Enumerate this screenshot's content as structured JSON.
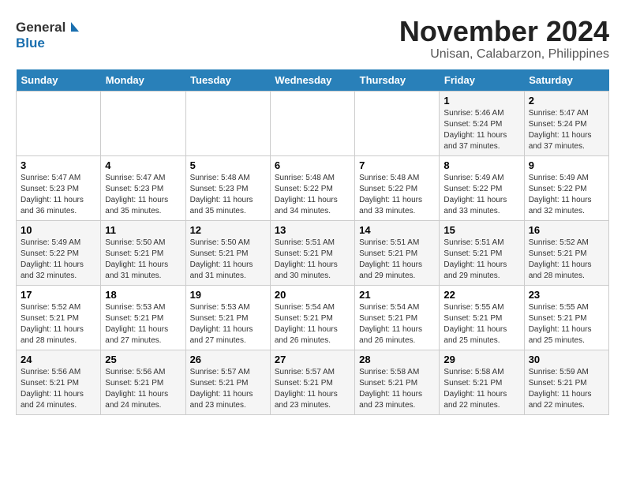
{
  "header": {
    "logo_general": "General",
    "logo_blue": "Blue",
    "month_title": "November 2024",
    "location": "Unisan, Calabarzon, Philippines"
  },
  "weekdays": [
    "Sunday",
    "Monday",
    "Tuesday",
    "Wednesday",
    "Thursday",
    "Friday",
    "Saturday"
  ],
  "weeks": [
    [
      {
        "day": "",
        "sunrise": "",
        "sunset": "",
        "daylight": ""
      },
      {
        "day": "",
        "sunrise": "",
        "sunset": "",
        "daylight": ""
      },
      {
        "day": "",
        "sunrise": "",
        "sunset": "",
        "daylight": ""
      },
      {
        "day": "",
        "sunrise": "",
        "sunset": "",
        "daylight": ""
      },
      {
        "day": "",
        "sunrise": "",
        "sunset": "",
        "daylight": ""
      },
      {
        "day": "1",
        "sunrise": "Sunrise: 5:46 AM",
        "sunset": "Sunset: 5:24 PM",
        "daylight": "Daylight: 11 hours and 37 minutes."
      },
      {
        "day": "2",
        "sunrise": "Sunrise: 5:47 AM",
        "sunset": "Sunset: 5:24 PM",
        "daylight": "Daylight: 11 hours and 37 minutes."
      }
    ],
    [
      {
        "day": "3",
        "sunrise": "Sunrise: 5:47 AM",
        "sunset": "Sunset: 5:23 PM",
        "daylight": "Daylight: 11 hours and 36 minutes."
      },
      {
        "day": "4",
        "sunrise": "Sunrise: 5:47 AM",
        "sunset": "Sunset: 5:23 PM",
        "daylight": "Daylight: 11 hours and 35 minutes."
      },
      {
        "day": "5",
        "sunrise": "Sunrise: 5:48 AM",
        "sunset": "Sunset: 5:23 PM",
        "daylight": "Daylight: 11 hours and 35 minutes."
      },
      {
        "day": "6",
        "sunrise": "Sunrise: 5:48 AM",
        "sunset": "Sunset: 5:22 PM",
        "daylight": "Daylight: 11 hours and 34 minutes."
      },
      {
        "day": "7",
        "sunrise": "Sunrise: 5:48 AM",
        "sunset": "Sunset: 5:22 PM",
        "daylight": "Daylight: 11 hours and 33 minutes."
      },
      {
        "day": "8",
        "sunrise": "Sunrise: 5:49 AM",
        "sunset": "Sunset: 5:22 PM",
        "daylight": "Daylight: 11 hours and 33 minutes."
      },
      {
        "day": "9",
        "sunrise": "Sunrise: 5:49 AM",
        "sunset": "Sunset: 5:22 PM",
        "daylight": "Daylight: 11 hours and 32 minutes."
      }
    ],
    [
      {
        "day": "10",
        "sunrise": "Sunrise: 5:49 AM",
        "sunset": "Sunset: 5:22 PM",
        "daylight": "Daylight: 11 hours and 32 minutes."
      },
      {
        "day": "11",
        "sunrise": "Sunrise: 5:50 AM",
        "sunset": "Sunset: 5:21 PM",
        "daylight": "Daylight: 11 hours and 31 minutes."
      },
      {
        "day": "12",
        "sunrise": "Sunrise: 5:50 AM",
        "sunset": "Sunset: 5:21 PM",
        "daylight": "Daylight: 11 hours and 31 minutes."
      },
      {
        "day": "13",
        "sunrise": "Sunrise: 5:51 AM",
        "sunset": "Sunset: 5:21 PM",
        "daylight": "Daylight: 11 hours and 30 minutes."
      },
      {
        "day": "14",
        "sunrise": "Sunrise: 5:51 AM",
        "sunset": "Sunset: 5:21 PM",
        "daylight": "Daylight: 11 hours and 29 minutes."
      },
      {
        "day": "15",
        "sunrise": "Sunrise: 5:51 AM",
        "sunset": "Sunset: 5:21 PM",
        "daylight": "Daylight: 11 hours and 29 minutes."
      },
      {
        "day": "16",
        "sunrise": "Sunrise: 5:52 AM",
        "sunset": "Sunset: 5:21 PM",
        "daylight": "Daylight: 11 hours and 28 minutes."
      }
    ],
    [
      {
        "day": "17",
        "sunrise": "Sunrise: 5:52 AM",
        "sunset": "Sunset: 5:21 PM",
        "daylight": "Daylight: 11 hours and 28 minutes."
      },
      {
        "day": "18",
        "sunrise": "Sunrise: 5:53 AM",
        "sunset": "Sunset: 5:21 PM",
        "daylight": "Daylight: 11 hours and 27 minutes."
      },
      {
        "day": "19",
        "sunrise": "Sunrise: 5:53 AM",
        "sunset": "Sunset: 5:21 PM",
        "daylight": "Daylight: 11 hours and 27 minutes."
      },
      {
        "day": "20",
        "sunrise": "Sunrise: 5:54 AM",
        "sunset": "Sunset: 5:21 PM",
        "daylight": "Daylight: 11 hours and 26 minutes."
      },
      {
        "day": "21",
        "sunrise": "Sunrise: 5:54 AM",
        "sunset": "Sunset: 5:21 PM",
        "daylight": "Daylight: 11 hours and 26 minutes."
      },
      {
        "day": "22",
        "sunrise": "Sunrise: 5:55 AM",
        "sunset": "Sunset: 5:21 PM",
        "daylight": "Daylight: 11 hours and 25 minutes."
      },
      {
        "day": "23",
        "sunrise": "Sunrise: 5:55 AM",
        "sunset": "Sunset: 5:21 PM",
        "daylight": "Daylight: 11 hours and 25 minutes."
      }
    ],
    [
      {
        "day": "24",
        "sunrise": "Sunrise: 5:56 AM",
        "sunset": "Sunset: 5:21 PM",
        "daylight": "Daylight: 11 hours and 24 minutes."
      },
      {
        "day": "25",
        "sunrise": "Sunrise: 5:56 AM",
        "sunset": "Sunset: 5:21 PM",
        "daylight": "Daylight: 11 hours and 24 minutes."
      },
      {
        "day": "26",
        "sunrise": "Sunrise: 5:57 AM",
        "sunset": "Sunset: 5:21 PM",
        "daylight": "Daylight: 11 hours and 23 minutes."
      },
      {
        "day": "27",
        "sunrise": "Sunrise: 5:57 AM",
        "sunset": "Sunset: 5:21 PM",
        "daylight": "Daylight: 11 hours and 23 minutes."
      },
      {
        "day": "28",
        "sunrise": "Sunrise: 5:58 AM",
        "sunset": "Sunset: 5:21 PM",
        "daylight": "Daylight: 11 hours and 23 minutes."
      },
      {
        "day": "29",
        "sunrise": "Sunrise: 5:58 AM",
        "sunset": "Sunset: 5:21 PM",
        "daylight": "Daylight: 11 hours and 22 minutes."
      },
      {
        "day": "30",
        "sunrise": "Sunrise: 5:59 AM",
        "sunset": "Sunset: 5:21 PM",
        "daylight": "Daylight: 11 hours and 22 minutes."
      }
    ]
  ]
}
